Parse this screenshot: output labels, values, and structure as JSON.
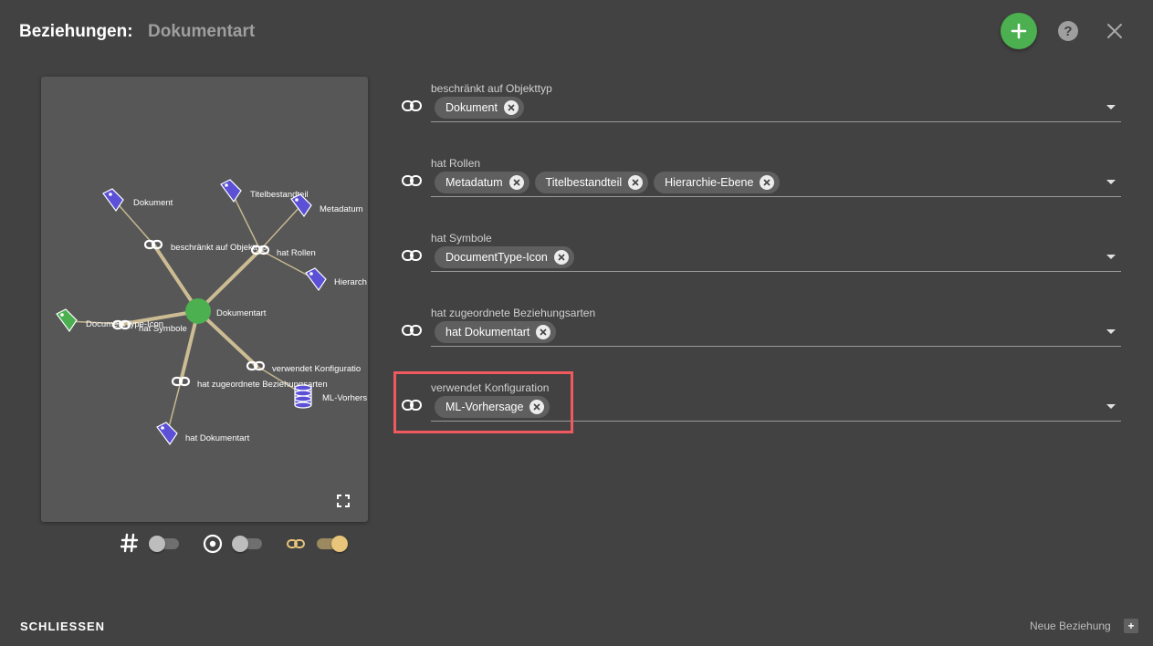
{
  "header": {
    "title": "Beziehungen:",
    "subtitle": "Dokumentart",
    "add_icon": "plus-icon",
    "help_label": "?",
    "close_icon": "close-icon"
  },
  "colors": {
    "background": "#424242",
    "accent_green": "#4caf50",
    "edge_color": "#d9c89a",
    "tag_blue": "#5b50d6",
    "highlight_red": "#f0595d",
    "toggle_active": "#e8c57a"
  },
  "graph": {
    "center": "Dokumentart",
    "nodes": [
      {
        "label": "Dokument",
        "icon": "tag-icon"
      },
      {
        "label": "beschränkt auf Objekttyp",
        "icon": "link-icon"
      },
      {
        "label": "Titelbestandteil",
        "icon": "tag-icon"
      },
      {
        "label": "Metadatum",
        "icon": "tag-icon"
      },
      {
        "label": "hat Rollen",
        "icon": "link-icon"
      },
      {
        "label": "Hierarch",
        "icon": "tag-icon"
      },
      {
        "label": "DocumentType-Icon",
        "icon": "tag-icon"
      },
      {
        "label": "hat Symbole",
        "icon": "link-icon"
      },
      {
        "label": "verwendet Konfiguratio",
        "icon": "link-icon"
      },
      {
        "label": "hat zugeordnete Beziehungsarten",
        "icon": "link-icon"
      },
      {
        "label": "ML-Vorhers",
        "icon": "database-icon"
      },
      {
        "label": "hat Dokumentart",
        "icon": "tag-icon"
      }
    ],
    "expand_icon": "expand-icon"
  },
  "toggles": [
    {
      "icon": "hash-icon",
      "on": false
    },
    {
      "icon": "target-icon",
      "on": false
    },
    {
      "icon": "link-icon",
      "on": true
    }
  ],
  "relations": [
    {
      "label": "beschränkt auf Objekttyp",
      "chips": [
        "Dokument"
      ]
    },
    {
      "label": "hat Rollen",
      "chips": [
        "Metadatum",
        "Titelbestandteil",
        "Hierarchie-Ebene"
      ]
    },
    {
      "label": "hat Symbole",
      "chips": [
        "DocumentType-Icon"
      ]
    },
    {
      "label": "hat zugeordnete Beziehungsarten",
      "chips": [
        "hat Dokumentart"
      ]
    },
    {
      "label": "verwendet Konfiguration",
      "chips": [
        "ML-Vorhersage"
      ]
    }
  ],
  "footer": {
    "close_label": "SCHLIESSEN",
    "new_relation_label": "Neue Beziehung",
    "new_relation_button": "+"
  }
}
